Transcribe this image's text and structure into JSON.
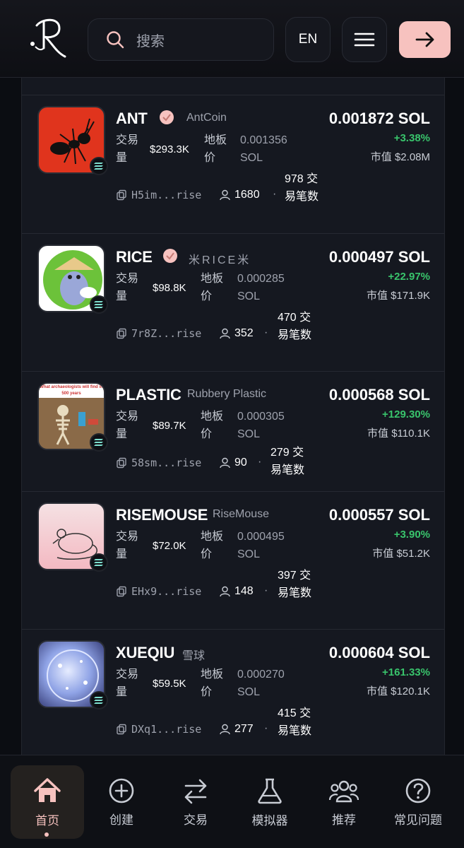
{
  "header": {
    "search_placeholder": "搜索",
    "lang": "EN"
  },
  "tokens": [
    {
      "symbol": "ANT",
      "name": "AntCoin",
      "verified": true,
      "volume_label": "交易量",
      "volume": "$293.3K",
      "floor_label": "地板价",
      "floor": "0.001356 SOL",
      "address": "H5im...rise",
      "holders": "1680",
      "trades_text": "978 交易笔数",
      "price": "0.001872 SOL",
      "change": "+3.38%",
      "mcap": "市值 $2.08M"
    },
    {
      "symbol": "RICE",
      "name": "米RICE米",
      "verified": true,
      "volume_label": "交易量",
      "volume": "$98.8K",
      "floor_label": "地板价",
      "floor": "0.000285 SOL",
      "address": "7r8Z...rise",
      "holders": "352",
      "trades_text": "470 交易笔数",
      "price": "0.000497 SOL",
      "change": "+22.97%",
      "mcap": "市值 $171.9K"
    },
    {
      "symbol": "PLASTIC",
      "name": "Rubbery Plastic",
      "verified": false,
      "image_caption": "What archaeologists will find in 500 years",
      "volume_label": "交易量",
      "volume": "$89.7K",
      "floor_label": "地板价",
      "floor": "0.000305 SOL",
      "address": "58sm...rise",
      "holders": "90",
      "trades_text": "279 交易笔数",
      "price": "0.000568 SOL",
      "change": "+129.30%",
      "mcap": "市值 $110.1K"
    },
    {
      "symbol": "RISEMOUSE",
      "name": "RiseMouse",
      "verified": false,
      "volume_label": "交易量",
      "volume": "$72.0K",
      "floor_label": "地板价",
      "floor": "0.000495 SOL",
      "address": "EHx9...rise",
      "holders": "148",
      "trades_text": "397 交易笔数",
      "price": "0.000557 SOL",
      "change": "+3.90%",
      "mcap": "市值 $51.2K"
    },
    {
      "symbol": "XUEQIU",
      "name": "雪球",
      "verified": false,
      "volume_label": "交易量",
      "volume": "$59.5K",
      "floor_label": "地板价",
      "floor": "0.000270 SOL",
      "address": "DXq1...rise",
      "holders": "277",
      "trades_text": "415 交易笔数",
      "price": "0.000604 SOL",
      "change": "+161.33%",
      "mcap": "市值 $120.1K"
    }
  ],
  "nav": {
    "home": "首页",
    "create": "创建",
    "trade": "交易",
    "simulator": "模拟器",
    "recommend": "推荐",
    "faq": "常见问题"
  },
  "colors": {
    "accent": "#f7c2bf",
    "positive": "#39c46c",
    "background": "#0b0d12",
    "card": "#151820"
  }
}
